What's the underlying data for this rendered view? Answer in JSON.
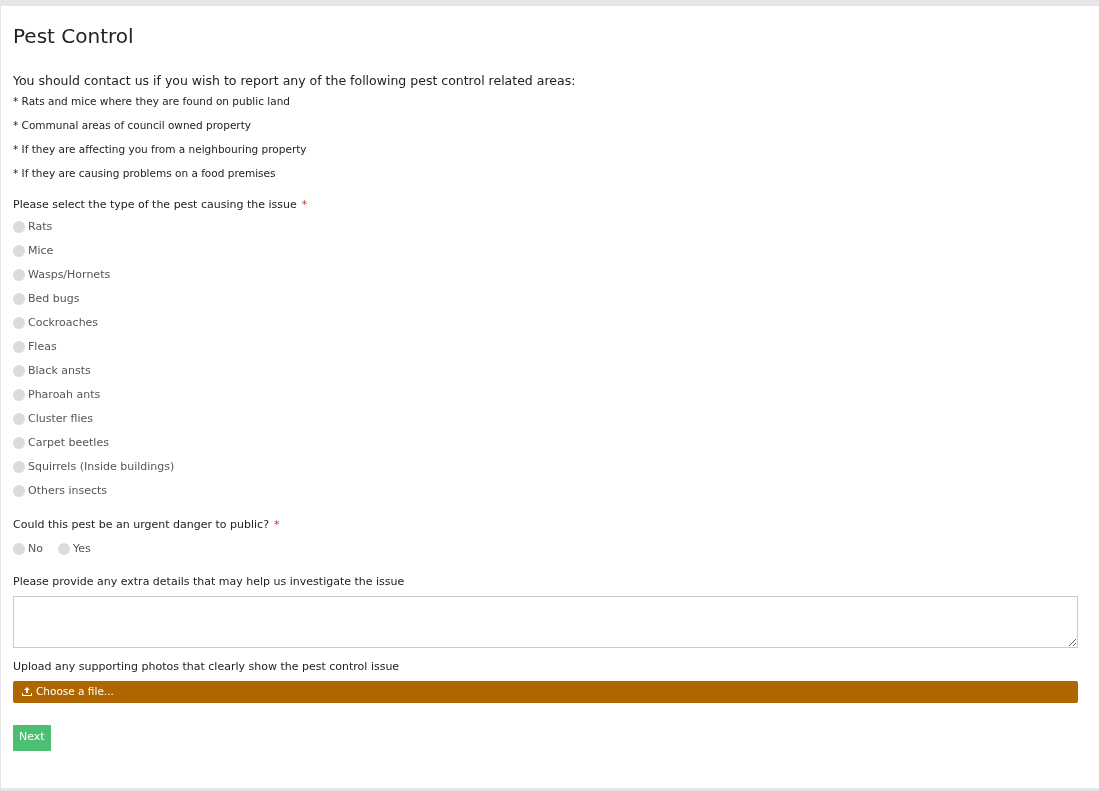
{
  "title": "Pest Control",
  "intro": "You should contact us if you wish to report any of the following pest control related areas:",
  "bullets": [
    "* Rats and mice where they are found on public land",
    "* Communal areas of council owned property",
    "* If they are affecting you from a neighbouring property",
    "* If they are causing problems on a food premises"
  ],
  "pest_question": {
    "label": "Please select the type of the pest causing the issue",
    "required_mark": "*",
    "options": [
      {
        "label": "Rats",
        "selected": false
      },
      {
        "label": "Mice",
        "selected": false
      },
      {
        "label": "Wasps/Hornets",
        "selected": false
      },
      {
        "label": "Bed bugs",
        "selected": false
      },
      {
        "label": "Cockroaches",
        "selected": false
      },
      {
        "label": "Fleas",
        "selected": false
      },
      {
        "label": "Black ansts",
        "selected": false
      },
      {
        "label": "Pharoah ants",
        "selected": false
      },
      {
        "label": "Cluster flies",
        "selected": false
      },
      {
        "label": "Carpet beetles",
        "selected": false
      },
      {
        "label": "Squirrels (Inside buildings)",
        "selected": false
      },
      {
        "label": "Others insects",
        "selected": false
      }
    ]
  },
  "danger_question": {
    "label": "Could this pest be an urgent danger to public?",
    "required_mark": "*",
    "options": [
      {
        "label": "No",
        "selected": false
      },
      {
        "label": "Yes",
        "selected": false
      }
    ]
  },
  "details": {
    "label": "Please provide any extra details that may help us investigate the issue"
  },
  "upload": {
    "label": "Upload any supporting photos that clearly show the pest control issue",
    "button": "Choose a file..."
  },
  "next_button": "Next"
}
